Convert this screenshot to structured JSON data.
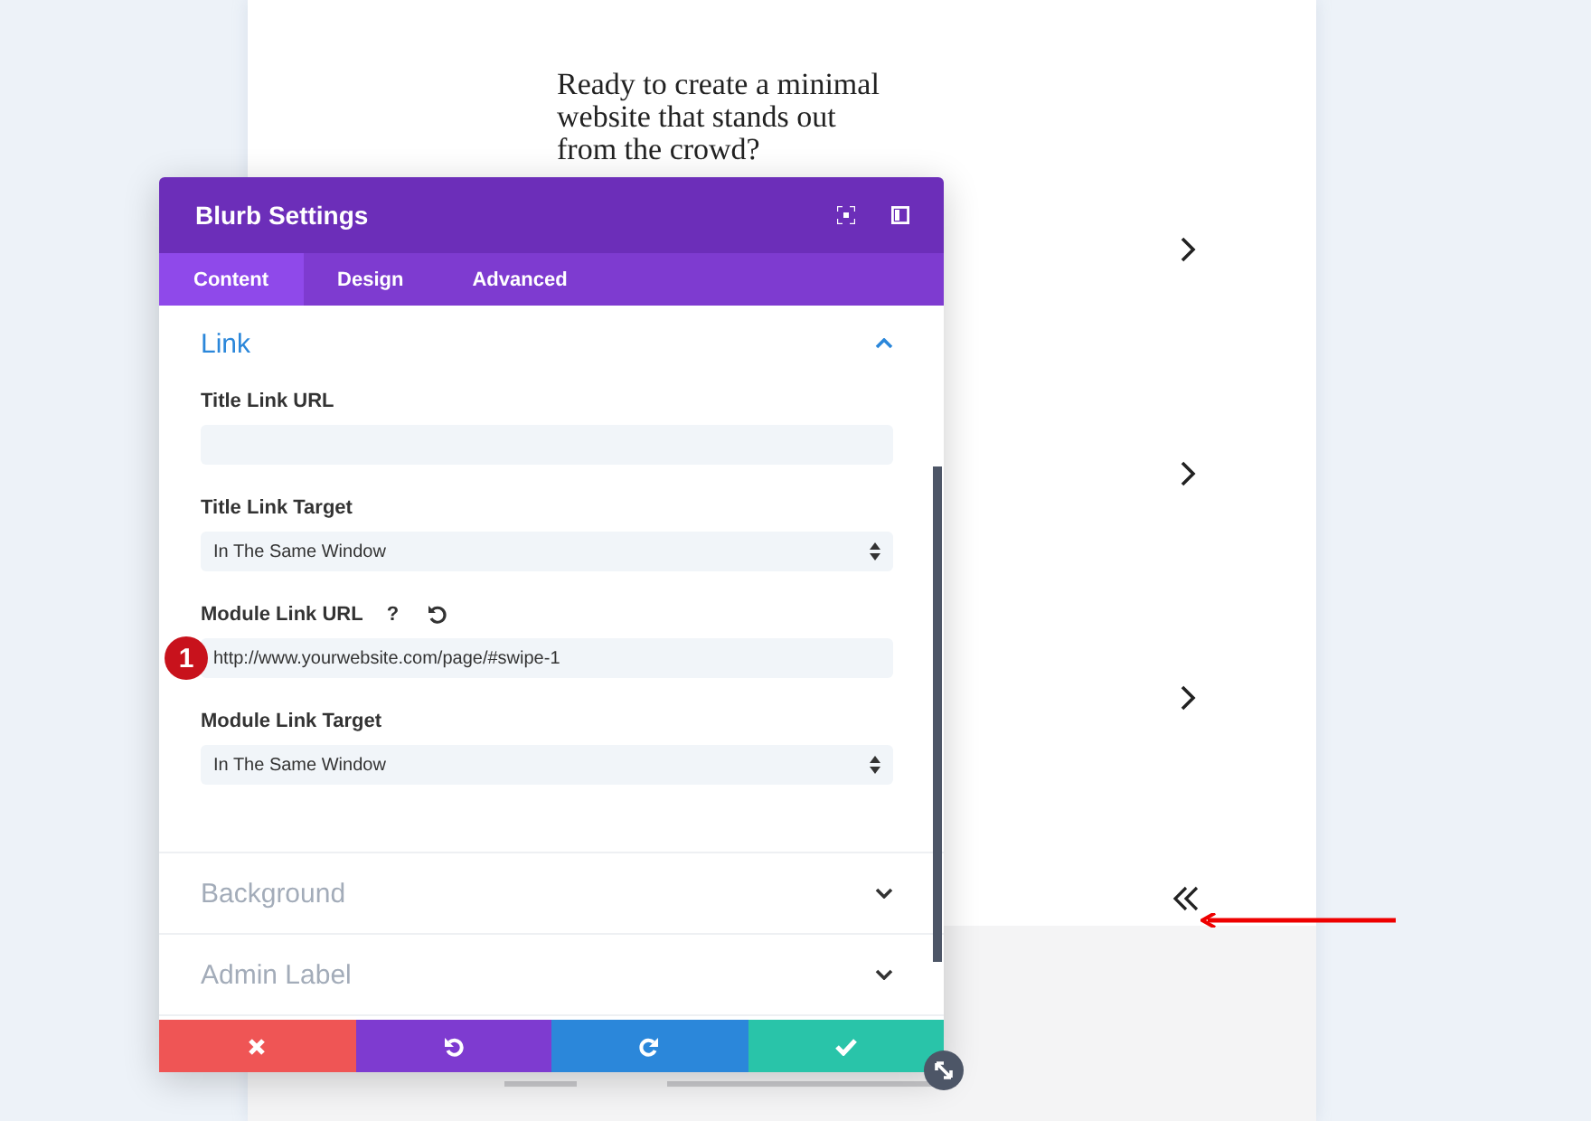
{
  "page": {
    "headline": "Ready to create a minimal website that stands out from the crowd?"
  },
  "modal": {
    "title": "Blurb Settings",
    "tabs": [
      {
        "label": "Content",
        "selected": true
      },
      {
        "label": "Design",
        "selected": false
      },
      {
        "label": "Advanced",
        "selected": false
      }
    ],
    "sections": [
      {
        "title": "Link",
        "expanded": true,
        "fields": [
          {
            "kind": "text",
            "label": "Title Link URL",
            "reset_button": false
          },
          {
            "kind": "select",
            "label": "Title Link Target",
            "value": "In The Same Window",
            "reset_button": false
          },
          {
            "kind": "text",
            "label": "Module Link URL",
            "value": "http://www.yourwebsite.com/page/#swipe-1",
            "help": "?",
            "reset_button": true,
            "badge": "1"
          },
          {
            "kind": "select",
            "label": "Module Link Target",
            "value": "In The Same Window",
            "reset_button": false
          }
        ]
      },
      {
        "title": "Background",
        "expanded": false
      },
      {
        "title": "Admin Label",
        "expanded": false
      }
    ],
    "actions": [
      {
        "kind": "cancel"
      },
      {
        "kind": "undo"
      },
      {
        "kind": "redo"
      },
      {
        "kind": "save"
      }
    ]
  }
}
